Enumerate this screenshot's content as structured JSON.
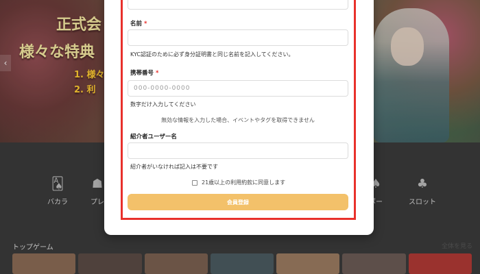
{
  "banner": {
    "title_line1": "正式会",
    "title_line2": "様々な特典",
    "line1": "1. 様々",
    "line2": "2. 利"
  },
  "categories": [
    {
      "label": "バカラ",
      "icon": "cards-icon"
    },
    {
      "label": "プレ",
      "icon": "dealer-icon"
    },
    {
      "label": "ポー",
      "icon": "chips-icon"
    },
    {
      "label": "スロット",
      "icon": "slot-icon"
    }
  ],
  "top_games": {
    "title": "トップゲーム",
    "see_all": "全体を見る"
  },
  "form": {
    "name": {
      "label": "名前",
      "required_mark": "*",
      "value": "",
      "hint": "KYC認証のために必ず身分証明書と同じ名前を記入してください。"
    },
    "phone": {
      "label": "携帯番号",
      "required_mark": "*",
      "placeholder": "000-0000-0000",
      "hint": "数字だけ入力してください"
    },
    "notice": "無効な情報を入力した場合、イベントやタグを取得できません",
    "referrer": {
      "label": "紹介者ユーザー名",
      "value": "",
      "hint": "紹介者がいなければ記入は不要です"
    },
    "agree_label": "21歳以上の利用約款に同意します",
    "submit_label": "会員登録"
  },
  "colors": {
    "required": "#e8302b",
    "submit_bg": "#f3c16a",
    "highlight": "#e8302b"
  }
}
